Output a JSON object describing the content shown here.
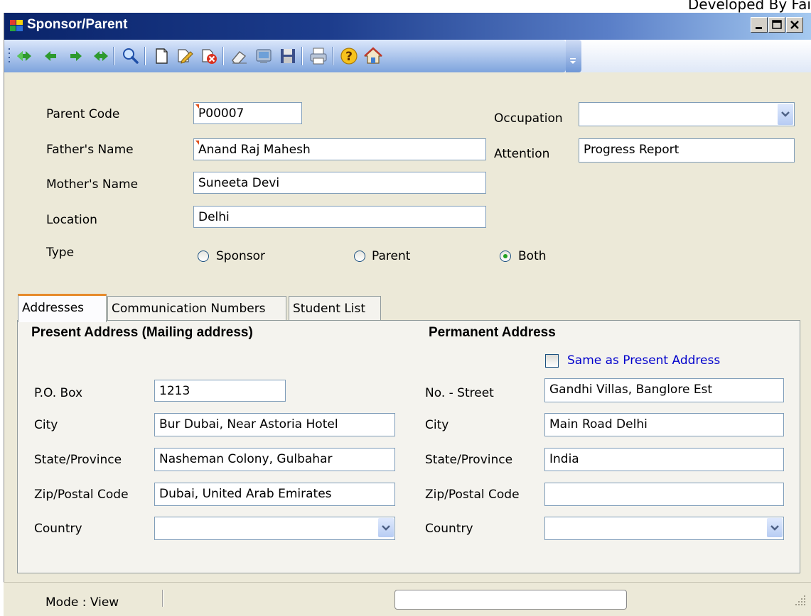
{
  "developer_note": "Developed By Fai",
  "window": {
    "title": "Sponsor/Parent"
  },
  "toolbar": {
    "icons": [
      "first-record-icon",
      "previous-record-icon",
      "next-record-icon",
      "last-record-icon",
      "find-icon",
      "new-document-icon",
      "edit-icon",
      "delete-icon",
      "clear-icon",
      "cancel-icon",
      "save-icon",
      "print-icon",
      "help-icon",
      "home-icon",
      "toolbar-overflow-icon"
    ]
  },
  "form": {
    "parent_code_label": "Parent Code",
    "parent_code": "P00007",
    "fathers_name_label": "Father's Name",
    "fathers_name": "Anand Raj Mahesh",
    "mothers_name_label": "Mother's Name",
    "mothers_name": "Suneeta Devi",
    "location_label": "Location",
    "location": "Delhi",
    "occupation_label": "Occupation",
    "occupation": "",
    "attention_label": "Attention",
    "attention": "Progress Report",
    "type_label": "Type",
    "type_options": [
      "Sponsor",
      "Parent",
      "Both"
    ],
    "type_selected": "Both"
  },
  "tabs": [
    {
      "label": "Addresses",
      "active": true
    },
    {
      "label": "Communication Numbers",
      "active": false
    },
    {
      "label": "Student List",
      "active": false
    }
  ],
  "present_address": {
    "heading": "Present  Address (Mailing address)",
    "po_box_label": "P.O. Box",
    "po_box": "1213",
    "city_label": "City",
    "city": "Bur Dubai, Near Astoria Hotel",
    "state_label": "State/Province",
    "state": "Nasheman Colony, Gulbahar",
    "zip_label": "Zip/Postal Code",
    "zip": "Dubai, United Arab Emirates",
    "country_label": "Country",
    "country": ""
  },
  "permanent_address": {
    "heading": "Permanent Address",
    "same_as_present_label": "Same as Present Address",
    "same_as_present": false,
    "street_label": "No. - Street",
    "street": "Gandhi Villas, Banglore Est",
    "city_label": "City",
    "city": "Main Road Delhi",
    "state_label": "State/Province",
    "state": "India",
    "zip_label": "Zip/Postal Code",
    "zip": "",
    "country_label": "Country",
    "country": ""
  },
  "status_bar": {
    "mode": "Mode : View"
  },
  "colors": {
    "title_bar": "#0a246a",
    "tab_accent": "#e68b2c",
    "link_blue": "#0000cc",
    "window_bg": "#ece9d8"
  }
}
